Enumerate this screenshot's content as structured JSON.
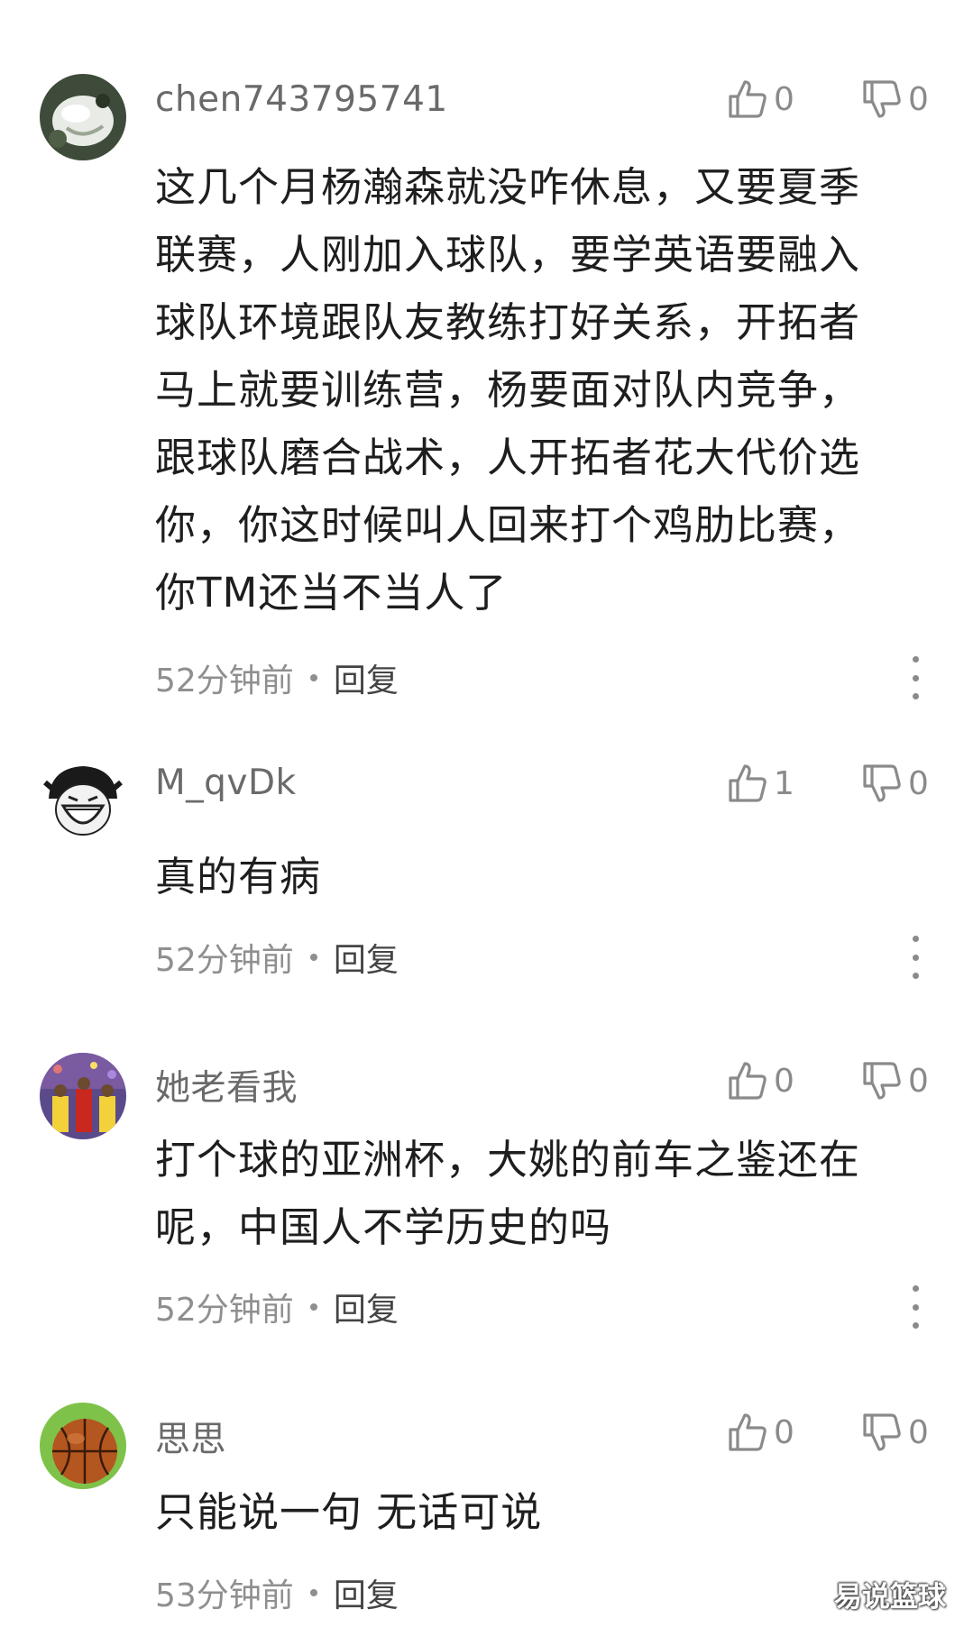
{
  "comments": [
    {
      "username": "chen743795741",
      "likes": "0",
      "dislikes": "0",
      "lines": [
        "这几个月杨瀚森就没咋休息，又要夏季",
        "联赛，人刚加入球队，要学英语要融入",
        "球队环境跟队友教练打好关系，开拓者",
        "马上就要训练营，杨要面对队内竞争，",
        "跟球队磨合战术，人开拓者花大代价选",
        "你，你这时候叫人回来打个鸡肋比赛，",
        "你TM还当不当人了"
      ],
      "time": "52分钟前",
      "reply": "回复"
    },
    {
      "username": "M_qvDk",
      "likes": "1",
      "dislikes": "0",
      "lines": [
        "真的有病"
      ],
      "time": "52分钟前",
      "reply": "回复"
    },
    {
      "username": "她老看我",
      "likes": "0",
      "dislikes": "0",
      "lines": [
        "打个球的亚洲杯，大姚的前车之鉴还在",
        "呢，中国人不学历史的吗"
      ],
      "time": "52分钟前",
      "reply": "回复"
    },
    {
      "username": "思思",
      "likes": "0",
      "dislikes": "0",
      "lines": [
        "只能说一句 无话可说"
      ],
      "time": "53分钟前",
      "reply": "回复"
    }
  ],
  "watermark": "易说篮球",
  "icons": {
    "like": "thumbs-up-icon",
    "dislike": "thumbs-down-icon",
    "more": "more-vertical-icon"
  },
  "colors": {
    "username": "#6a6a6a",
    "body": "#1e1e1e",
    "meta": "#8f8f8f",
    "icon": "#8a8a8a"
  }
}
